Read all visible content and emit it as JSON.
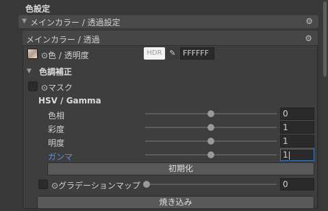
{
  "section": {
    "title": "色設定"
  },
  "outer_foldout": {
    "label": "メインカラー / 透過設定"
  },
  "panel": {
    "title": "メインカラー / 透過",
    "color_row": {
      "label": "⊙色 / 透明度",
      "hdr": "HDR",
      "hex": "FFFFFF"
    },
    "color_correction": {
      "title": "色調補正",
      "mask_label": "⊙マスク",
      "hsv_title": "HSV / Gamma",
      "sliders": [
        {
          "label": "色相",
          "value": "0",
          "level": 0.5
        },
        {
          "label": "彩度",
          "value": "1",
          "level": 0.5
        },
        {
          "label": "明度",
          "value": "1",
          "level": 0.5
        },
        {
          "label": "ガンマ",
          "value": "1",
          "level": 0.5
        }
      ],
      "reset_label": "初期化"
    },
    "gradient": {
      "label": "⊙グラデーションマップ",
      "value": "0",
      "level": 0.0
    },
    "bake_label": "焼き込み"
  },
  "colors": {
    "accent": "#5a93d8",
    "background": "#383838"
  }
}
